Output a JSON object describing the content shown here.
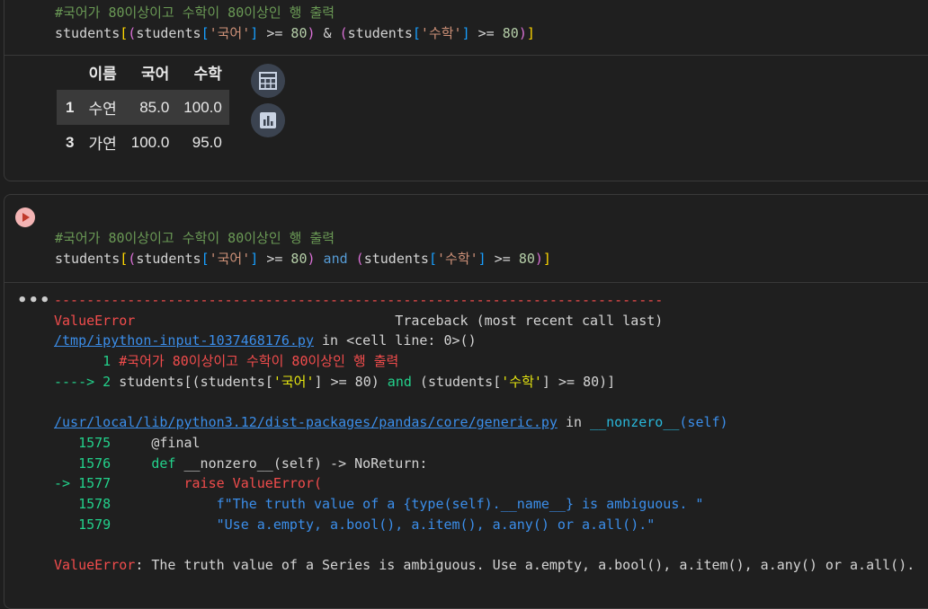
{
  "cell1": {
    "code_lines": [
      [
        {
          "t": "#국어가 80이상이고 수학이 80이상인 행 출력",
          "c": "c-comment"
        }
      ],
      [
        {
          "t": "students",
          "c": "c-plain"
        },
        {
          "t": "[",
          "c": "c-br1"
        },
        {
          "t": "(",
          "c": "c-br2"
        },
        {
          "t": "students",
          "c": "c-plain"
        },
        {
          "t": "[",
          "c": "c-br3"
        },
        {
          "t": "'국어'",
          "c": "c-str"
        },
        {
          "t": "]",
          "c": "c-br3"
        },
        {
          "t": " >= ",
          "c": "c-plain"
        },
        {
          "t": "80",
          "c": "c-num"
        },
        {
          "t": ")",
          "c": "c-br2"
        },
        {
          "t": " & ",
          "c": "c-plain"
        },
        {
          "t": "(",
          "c": "c-br2"
        },
        {
          "t": "students",
          "c": "c-plain"
        },
        {
          "t": "[",
          "c": "c-br3"
        },
        {
          "t": "'수학'",
          "c": "c-str"
        },
        {
          "t": "]",
          "c": "c-br3"
        },
        {
          "t": " >= ",
          "c": "c-plain"
        },
        {
          "t": "80",
          "c": "c-num"
        },
        {
          "t": ")",
          "c": "c-br2"
        },
        {
          "t": "]",
          "c": "c-br1"
        }
      ]
    ],
    "table": {
      "columns": [
        "이름",
        "국어",
        "수학"
      ],
      "rows": [
        {
          "index": "1",
          "cells": [
            "수연",
            "85.0",
            "100.0"
          ],
          "highlight": true
        },
        {
          "index": "3",
          "cells": [
            "가연",
            "100.0",
            "95.0"
          ],
          "highlight": false
        }
      ]
    },
    "buttons": {
      "table_icon": "table-icon",
      "chart_icon": "bar-chart-icon"
    }
  },
  "cell2": {
    "code_lines": [
      [
        {
          "t": "#국어가 80이상이고 수학이 80이상인 행 출력",
          "c": "c-comment"
        }
      ],
      [
        {
          "t": "students",
          "c": "c-plain"
        },
        {
          "t": "[",
          "c": "c-br1"
        },
        {
          "t": "(",
          "c": "c-br2"
        },
        {
          "t": "students",
          "c": "c-plain"
        },
        {
          "t": "[",
          "c": "c-br3"
        },
        {
          "t": "'국어'",
          "c": "c-str"
        },
        {
          "t": "]",
          "c": "c-br3"
        },
        {
          "t": " >= ",
          "c": "c-plain"
        },
        {
          "t": "80",
          "c": "c-num"
        },
        {
          "t": ")",
          "c": "c-br2"
        },
        {
          "t": " and ",
          "c": "c-kw"
        },
        {
          "t": "(",
          "c": "c-br2"
        },
        {
          "t": "students",
          "c": "c-plain"
        },
        {
          "t": "[",
          "c": "c-br3"
        },
        {
          "t": "'수학'",
          "c": "c-str"
        },
        {
          "t": "]",
          "c": "c-br3"
        },
        {
          "t": " >= ",
          "c": "c-plain"
        },
        {
          "t": "80",
          "c": "c-num"
        },
        {
          "t": ")",
          "c": "c-br2"
        },
        {
          "t": "]",
          "c": "c-br1"
        }
      ]
    ],
    "output_lines": [
      [
        {
          "t": "---------------------------------------------------------------------------",
          "c": "c-red"
        }
      ],
      [
        {
          "t": "ValueError",
          "c": "c-red"
        },
        {
          "t": "                                Traceback (most recent call last)",
          "c": "c-plain"
        }
      ],
      [
        {
          "t": "/tmp/ipython-input-1037468176.py",
          "c": "c-link"
        },
        {
          "t": " in ",
          "c": "c-plain"
        },
        {
          "t": "<cell line: 0>()",
          "c": "c-plain"
        }
      ],
      [
        {
          "t": "      1 ",
          "c": "c-green"
        },
        {
          "t": "#국어가 80이상이고 수학이 80이상인 행 출력",
          "c": "c-red"
        }
      ],
      [
        {
          "t": "----> 2 ",
          "c": "c-green"
        },
        {
          "t": "students",
          "c": "c-plain"
        },
        {
          "t": "[",
          "c": "c-plain"
        },
        {
          "t": "(",
          "c": "c-plain"
        },
        {
          "t": "students",
          "c": "c-plain"
        },
        {
          "t": "[",
          "c": "c-plain"
        },
        {
          "t": "'국어'",
          "c": "c-yellow"
        },
        {
          "t": "]",
          "c": "c-plain"
        },
        {
          "t": " >= ",
          "c": "c-plain"
        },
        {
          "t": "80",
          "c": "c-plain"
        },
        {
          "t": ")",
          "c": "c-plain"
        },
        {
          "t": " and ",
          "c": "c-green"
        },
        {
          "t": "(",
          "c": "c-plain"
        },
        {
          "t": "students",
          "c": "c-plain"
        },
        {
          "t": "[",
          "c": "c-plain"
        },
        {
          "t": "'수학'",
          "c": "c-yellow"
        },
        {
          "t": "]",
          "c": "c-plain"
        },
        {
          "t": " >= ",
          "c": "c-plain"
        },
        {
          "t": "80",
          "c": "c-plain"
        },
        {
          "t": ")",
          "c": "c-plain"
        },
        {
          "t": "]",
          "c": "c-plain"
        }
      ],
      [
        {
          "t": "",
          "c": "c-plain"
        }
      ],
      [
        {
          "t": "/usr/local/lib/python3.12/dist-packages/pandas/core/generic.py",
          "c": "c-link"
        },
        {
          "t": " in ",
          "c": "c-plain"
        },
        {
          "t": "__nonzero__",
          "c": "c-cyan"
        },
        {
          "t": "(self)",
          "c": "c-blue"
        }
      ],
      [
        {
          "t": "   1575 ",
          "c": "c-green"
        },
        {
          "t": "    @final",
          "c": "c-plain"
        }
      ],
      [
        {
          "t": "   1576 ",
          "c": "c-green"
        },
        {
          "t": "    ",
          "c": "c-plain"
        },
        {
          "t": "def",
          "c": "c-green"
        },
        {
          "t": " __nonzero__",
          "c": "c-plain"
        },
        {
          "t": "(self)",
          "c": "c-plain"
        },
        {
          "t": " -> NoReturn:",
          "c": "c-plain"
        }
      ],
      [
        {
          "t": "-> 1577 ",
          "c": "c-green"
        },
        {
          "t": "        ",
          "c": "c-plain"
        },
        {
          "t": "raise",
          "c": "c-red"
        },
        {
          "t": " ValueError(",
          "c": "c-red"
        }
      ],
      [
        {
          "t": "   1578 ",
          "c": "c-green"
        },
        {
          "t": "            f\"The truth value of a {type(self).__name__} is ambiguous. \"",
          "c": "c-blue"
        }
      ],
      [
        {
          "t": "   1579 ",
          "c": "c-green"
        },
        {
          "t": "            \"Use a.empty, a.bool(), a.item(), a.any() or a.all().\"",
          "c": "c-blue"
        }
      ],
      [
        {
          "t": "",
          "c": "c-plain"
        }
      ],
      [
        {
          "t": "ValueError",
          "c": "c-red"
        },
        {
          "t": ": The truth value of a Series is ambiguous. Use a.empty, a.bool(), a.item(), a.any() or a.all().",
          "c": "c-plain"
        }
      ]
    ]
  },
  "colors": {
    "run_button": "#f3b4b4",
    "icon_button": "#3b4350",
    "background": "#1e1e1e"
  }
}
